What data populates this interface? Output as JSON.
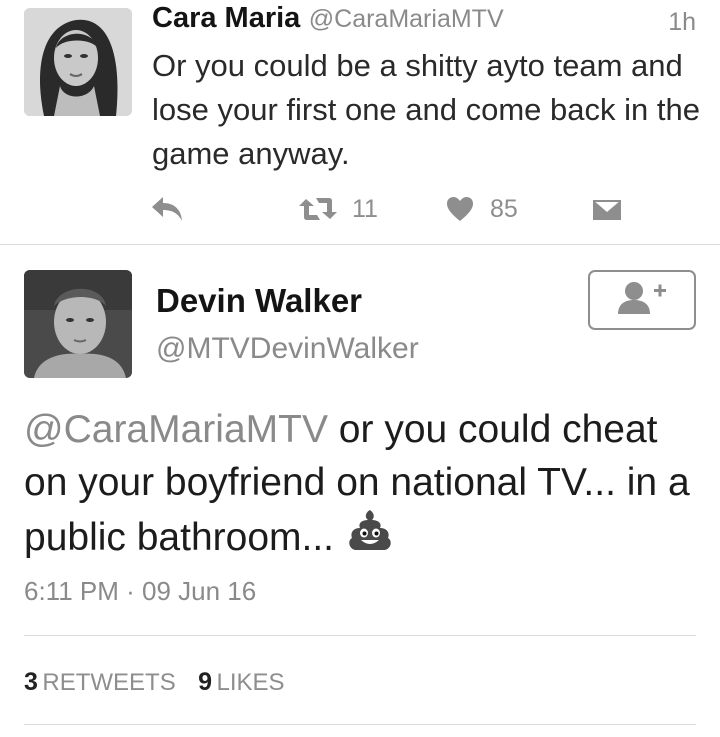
{
  "tweet1": {
    "name": "Cara Maria",
    "handle": "@CaraMariaMTV",
    "time": "1h",
    "text": "Or you could be a shitty ayto team and lose your first one and come back in the game anyway.",
    "actions": {
      "reply_icon": "reply-icon",
      "retweet_icon": "retweet-icon",
      "retweet_count": "11",
      "like_icon": "heart-icon",
      "like_count": "85",
      "dm_icon": "envelope-icon"
    }
  },
  "tweet2": {
    "name": "Devin Walker",
    "handle": "@MTVDevinWalker",
    "follow_icon": "add-user-icon",
    "mention": "@CaraMariaMTV",
    "text_line1_rest": " or you could cheat",
    "text_line2": "on your boyfriend on national TV... in a",
    "text_line3": "public bathroom...",
    "emoji": "pile-of-poo-icon",
    "timestamp": "6:11 PM · 09 Jun 16",
    "retweets_count": "3",
    "retweets_label": "RETWEETS",
    "likes_count": "9",
    "likes_label": "LIKES"
  }
}
